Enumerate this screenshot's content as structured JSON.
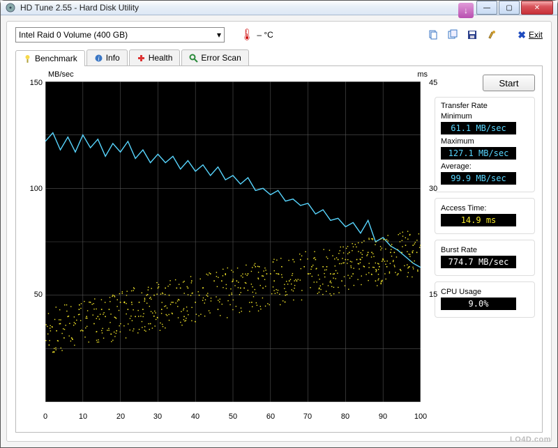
{
  "window": {
    "title": "HD Tune 2.55 - Hard Disk Utility"
  },
  "toolbar": {
    "drive_selected": "Intel   Raid 0 Volume (400 GB)",
    "temperature": "– °C",
    "exit_label": "Exit"
  },
  "tabs": {
    "benchmark": "Benchmark",
    "info": "Info",
    "health": "Health",
    "error_scan": "Error Scan"
  },
  "buttons": {
    "start": "Start"
  },
  "results": {
    "transfer_rate": {
      "title": "Transfer Rate",
      "minimum_label": "Minimum",
      "minimum_value": "61.1 MB/sec",
      "maximum_label": "Maximum",
      "maximum_value": "127.1 MB/sec",
      "average_label": "Average:",
      "average_value": "99.9 MB/sec"
    },
    "access_time": {
      "label": "Access Time:",
      "value": "14.9 ms"
    },
    "burst_rate": {
      "label": "Burst Rate",
      "value": "774.7 MB/sec"
    },
    "cpu_usage": {
      "label": "CPU Usage",
      "value": "9.0%"
    }
  },
  "watermark": "LO4D.com",
  "chart_data": {
    "type": [
      "line",
      "scatter"
    ],
    "title": "",
    "xlabel": "",
    "ylabel_left": "MB/sec",
    "ylabel_right": "ms",
    "xlim": [
      0,
      100
    ],
    "ylim_left": [
      0,
      150
    ],
    "ylim_right": [
      0,
      45
    ],
    "x_ticks": [
      0,
      10,
      20,
      30,
      40,
      50,
      60,
      70,
      80,
      90,
      100
    ],
    "y_left_ticks": [
      50,
      100,
      150
    ],
    "y_right_ticks": [
      15,
      30,
      45
    ],
    "series": [
      {
        "name": "Transfer Rate (MB/sec)",
        "axis": "left",
        "type": "line",
        "color": "#58d6ff",
        "x": [
          0,
          2,
          4,
          6,
          8,
          10,
          12,
          14,
          16,
          18,
          20,
          22,
          24,
          26,
          28,
          30,
          32,
          34,
          36,
          38,
          40,
          42,
          44,
          46,
          48,
          50,
          52,
          54,
          56,
          58,
          60,
          62,
          64,
          66,
          68,
          70,
          72,
          74,
          76,
          78,
          80,
          82,
          84,
          86,
          88,
          90,
          92,
          94,
          96,
          98,
          100
        ],
        "y": [
          122,
          126,
          118,
          124,
          117,
          125,
          119,
          123,
          115,
          121,
          117,
          122,
          114,
          118,
          112,
          116,
          112,
          115,
          109,
          113,
          108,
          111,
          106,
          110,
          104,
          106,
          102,
          105,
          99,
          100,
          97,
          99,
          94,
          95,
          92,
          93,
          88,
          90,
          85,
          86,
          82,
          84,
          79,
          85,
          75,
          77,
          73,
          71,
          68,
          65,
          63
        ]
      },
      {
        "name": "Access Time (ms)",
        "axis": "right",
        "type": "scatter",
        "color": "#f7e92b",
        "x": [
          1,
          3,
          4,
          6,
          7,
          9,
          10,
          12,
          13,
          15,
          16,
          18,
          19,
          21,
          22,
          24,
          25,
          27,
          28,
          30,
          31,
          33,
          34,
          36,
          37,
          39,
          40,
          42,
          43,
          45,
          46,
          48,
          49,
          51,
          52,
          54,
          55,
          57,
          58,
          60,
          61,
          63,
          64,
          66,
          67,
          69,
          70,
          72,
          73,
          75,
          76,
          78,
          79,
          81,
          82,
          84,
          85,
          87,
          88,
          90,
          91,
          93,
          94,
          96,
          97,
          99,
          5,
          11,
          17,
          23,
          29,
          35,
          41,
          47,
          53,
          59,
          65,
          71,
          77,
          83,
          89,
          95,
          2,
          8,
          14,
          20,
          26,
          32,
          38,
          44,
          50,
          56,
          62,
          68,
          74,
          80,
          86,
          92,
          98,
          100
        ],
        "y": [
          8,
          10,
          11,
          12,
          9,
          13,
          10,
          14,
          11,
          13,
          12,
          15,
          10,
          14,
          13,
          12,
          14,
          15,
          11,
          16,
          13,
          15,
          14,
          16,
          12,
          17,
          14,
          16,
          15,
          17,
          13,
          18,
          15,
          17,
          16,
          18,
          14,
          19,
          16,
          18,
          17,
          19,
          15,
          20,
          17,
          19,
          18,
          20,
          16,
          19,
          18,
          20,
          17,
          21,
          18,
          20,
          19,
          21,
          17,
          20,
          19,
          21,
          18,
          22,
          19,
          21,
          9,
          12,
          13,
          14,
          15,
          16,
          15,
          17,
          16,
          18,
          17,
          19,
          18,
          20,
          19,
          21,
          7,
          11,
          12,
          14,
          13,
          16,
          16,
          18,
          17,
          19,
          18,
          20,
          19,
          20,
          21,
          21,
          22,
          22
        ]
      }
    ]
  }
}
